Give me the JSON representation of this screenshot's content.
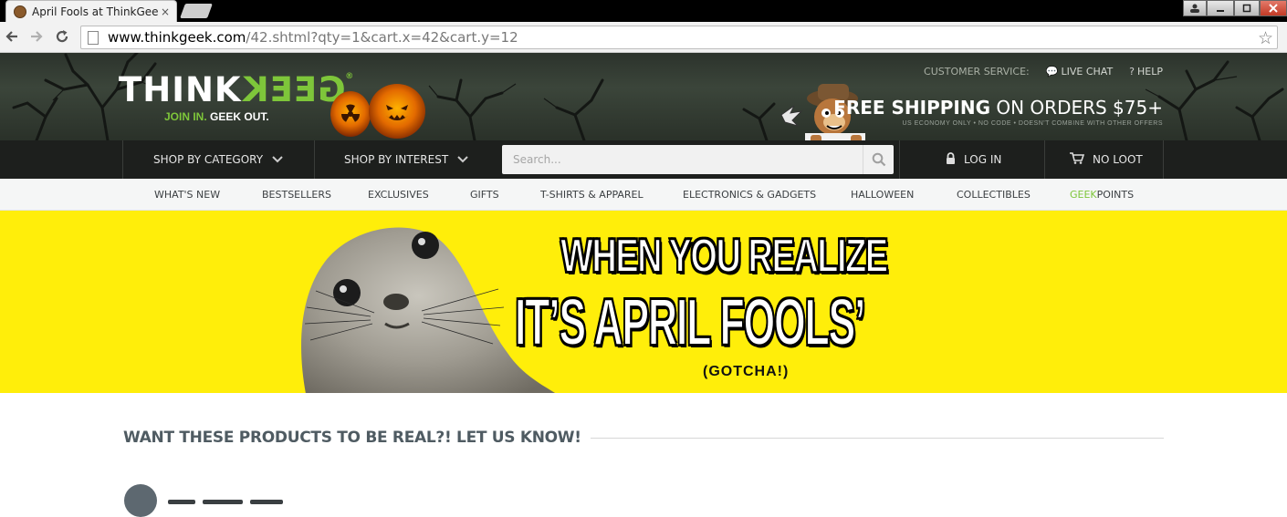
{
  "browser": {
    "tab_title": "April Fools at ThinkGeek -",
    "tab_close": "×",
    "url_host": "www.thinkgeek.com",
    "url_path": "/42.shtml?qty=1&cart.x=42&cart.y=12",
    "back_icon": "arrow-left-icon",
    "forward_icon": "arrow-right-icon",
    "reload_icon": "reload-icon",
    "bookmark_icon": "star-icon"
  },
  "header": {
    "logo_think": "THINK",
    "logo_geek": "GEEK",
    "tagline_join": "JOIN IN.",
    "tagline_geek": "GEEK OUT.",
    "trademark": "®",
    "customer_service": "CUSTOMER SERVICE:",
    "live_chat": "LIVE CHAT",
    "help": "HELP",
    "shipping_bold": "FREE SHIPPING",
    "shipping_rest": "ON ORDERS $75+",
    "shipping_fine": "US ECONOMY ONLY • NO CODE • DOESN'T COMBINE WITH OTHER OFFERS"
  },
  "mainnav": {
    "shop_by_category": "SHOP BY CATEGORY",
    "shop_by_interest": "SHOP BY INTEREST",
    "search_placeholder": "Search...",
    "log_in": "LOG IN",
    "no_loot": "NO LOOT"
  },
  "subnav": {
    "items": [
      "WHAT'S NEW",
      "BESTSELLERS",
      "EXCLUSIVES",
      "GIFTS",
      "T-SHIRTS & APPAREL",
      "ELECTRONICS & GADGETS",
      "HALLOWEEN",
      "COLLECTIBLES"
    ],
    "geekpoints_green": "GEEK",
    "geekpoints_rest": "POINTS"
  },
  "banner": {
    "line1": "WHEN YOU REALIZE",
    "line2": "IT’S APRIL FOOLS’",
    "gotcha": "(GOTCHA!)",
    "background": "#ffee0a"
  },
  "section": {
    "title": "WANT THESE PRODUCTS TO BE REAL?!  LET US KNOW!"
  },
  "colors": {
    "brand_green": "#7ec63a",
    "nav_dark": "#1d1f1d",
    "section_text": "#4f5b62"
  }
}
